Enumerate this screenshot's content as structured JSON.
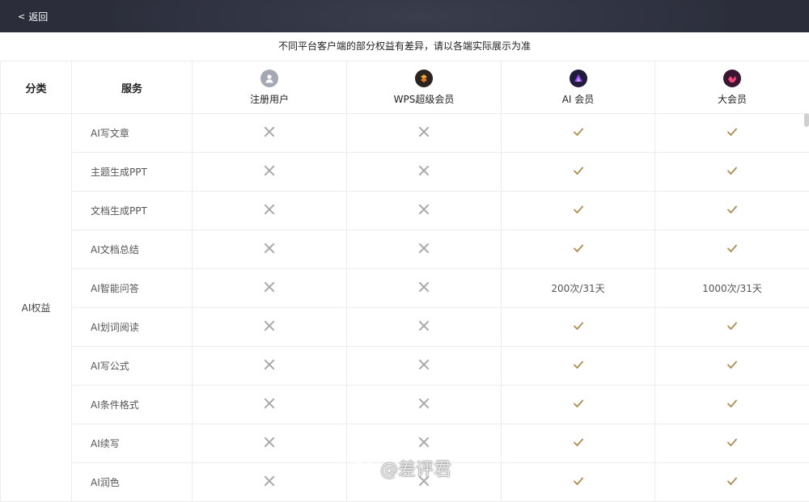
{
  "header": {
    "back_label": "返回"
  },
  "notice": "不同平台客户端的部分权益有差异，请以各端实际展示为准",
  "table": {
    "col_category": "分类",
    "col_service": "服务",
    "plans": [
      {
        "name": "注册用户",
        "icon": "user-icon",
        "color": "#9aa0ac"
      },
      {
        "name": "WPS超级会员",
        "icon": "wps-super-icon",
        "color": "#e79b2b"
      },
      {
        "name": "AI 会员",
        "icon": "ai-member-icon",
        "color": "#7b3ff2"
      },
      {
        "name": "大会员",
        "icon": "big-member-icon",
        "color": "#e8456b"
      }
    ],
    "category": "AI权益",
    "rows": [
      {
        "service": "AI写文章",
        "values": [
          "x",
          "x",
          "check",
          "check"
        ]
      },
      {
        "service": "主题生成PPT",
        "values": [
          "x",
          "x",
          "check",
          "check"
        ]
      },
      {
        "service": "文档生成PPT",
        "values": [
          "x",
          "x",
          "check",
          "check"
        ]
      },
      {
        "service": "AI文档总结",
        "values": [
          "x",
          "x",
          "check",
          "check"
        ]
      },
      {
        "service": "AI智能问答",
        "values": [
          "x",
          "x",
          "200次/31天",
          "1000次/31天"
        ]
      },
      {
        "service": "AI划词阅读",
        "values": [
          "x",
          "x",
          "check",
          "check"
        ]
      },
      {
        "service": "AI写公式",
        "values": [
          "x",
          "x",
          "check",
          "check"
        ]
      },
      {
        "service": "AI条件格式",
        "values": [
          "x",
          "x",
          "check",
          "check"
        ]
      },
      {
        "service": "AI续写",
        "values": [
          "x",
          "x",
          "check",
          "check"
        ]
      },
      {
        "service": "AI润色",
        "values": [
          "x",
          "x",
          "check",
          "check"
        ]
      }
    ]
  },
  "watermark": "@差评君",
  "colors": {
    "topbar": "#2b2e3a",
    "check": "#b08d52",
    "cross": "#a7a7ad"
  }
}
